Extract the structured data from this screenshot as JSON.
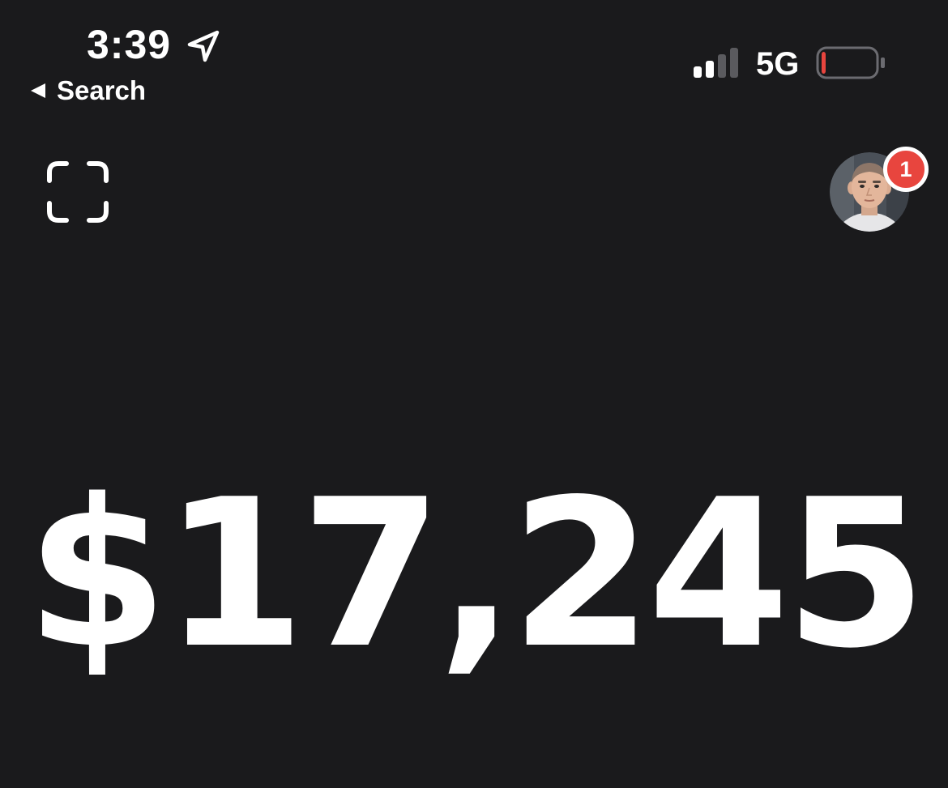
{
  "status_bar": {
    "time": "3:39",
    "network": "5G",
    "location_icon": "location-arrow-icon",
    "signal_bars_active": 2,
    "signal_bars_total": 4,
    "battery_level": 0.06,
    "battery_color": "#e8453e"
  },
  "navigation": {
    "back_label": "Search",
    "back_icon": "back-triangle-icon"
  },
  "header": {
    "scan_icon": "scan-frame-icon",
    "notification_count": "1",
    "badge_color": "#e8453e"
  },
  "balance": {
    "amount": "$17,245"
  },
  "theme": {
    "background": "#1a1a1c",
    "text": "#ffffff"
  }
}
